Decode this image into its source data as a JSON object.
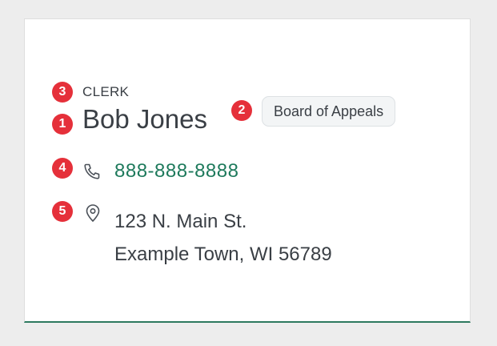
{
  "contact": {
    "role": "CLERK",
    "name": "Bob Jones",
    "board": "Board of Appeals",
    "phone": "888-888-8888",
    "address_line1": "123 N. Main St.",
    "address_line2": "Example Town, WI 56789"
  },
  "markers": [
    "1",
    "2",
    "3",
    "4",
    "5"
  ],
  "icons": {
    "phone": "phone-icon",
    "location": "map-pin-icon"
  },
  "colors": {
    "marker": "#e5303a",
    "link": "#1e7a5c",
    "accent_border": "#2d7a5f",
    "text": "#3a3f45"
  }
}
